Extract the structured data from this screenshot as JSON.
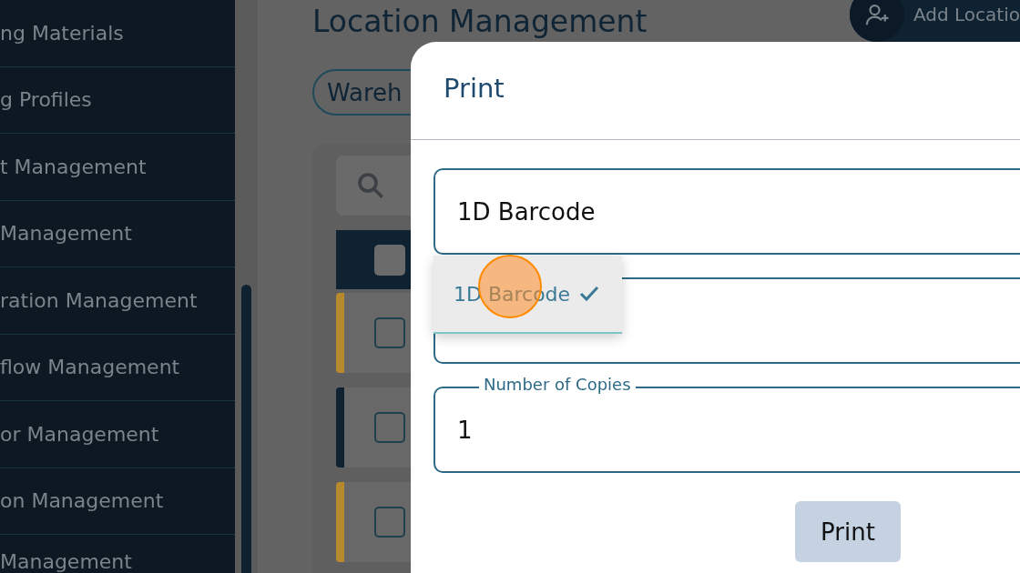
{
  "sidebar": {
    "items": [
      {
        "label": "ng Materials"
      },
      {
        "label": "g Profiles"
      },
      {
        "label": "t Management"
      },
      {
        "label": "Management"
      },
      {
        "label": "ration Management"
      },
      {
        "label": "flow Management"
      },
      {
        "label": "or Management"
      },
      {
        "label": "on Management"
      },
      {
        "label": "Management"
      }
    ]
  },
  "page": {
    "title": "Location Management",
    "add_button": "Add Locatio",
    "tab": "Wareh",
    "table": {
      "header_checked": false,
      "rows": [
        {
          "checked": false,
          "color": "#b88a2e"
        },
        {
          "checked": false,
          "color": "#0f2232"
        },
        {
          "checked": false,
          "color": "#b88a2e"
        }
      ]
    }
  },
  "dialog": {
    "title": "Print",
    "barcode_field": {
      "value": "1D Barcode"
    },
    "dropdown": {
      "options": [
        {
          "label": "1D Barcode",
          "selected": true
        }
      ]
    },
    "copies_field": {
      "label": "Number of Copies",
      "value": "1"
    },
    "print_button": "Print"
  }
}
